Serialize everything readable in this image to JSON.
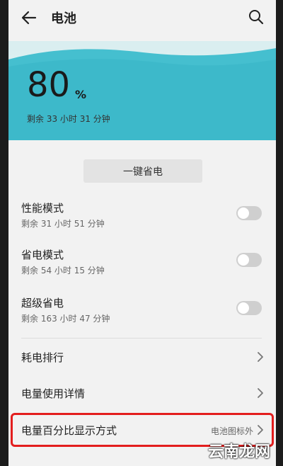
{
  "header": {
    "title": "电池"
  },
  "battery": {
    "percent_value": "80",
    "percent_sign": "%",
    "remaining": "剩余 33 小时 31 分钟",
    "level_fraction": 0.8
  },
  "actions": {
    "one_key_save": "一键省电"
  },
  "modes": [
    {
      "title": "性能模式",
      "subtitle": "剩余 31 小时 51 分钟",
      "enabled": false
    },
    {
      "title": "省电模式",
      "subtitle": "剩余 54 小时 15 分钟",
      "enabled": false
    },
    {
      "title": "超级省电",
      "subtitle": "剩余 163 小时 47 分钟",
      "enabled": false
    }
  ],
  "list": [
    {
      "label": "耗电排行"
    },
    {
      "label": "电量使用详情"
    },
    {
      "label": "电量百分比显示方式",
      "value": "电池图标外"
    }
  ],
  "watermark": {
    "text": "云南龙网"
  },
  "colors": {
    "accent_wave": "#3bb7c8",
    "highlight": "#e31e1e"
  }
}
